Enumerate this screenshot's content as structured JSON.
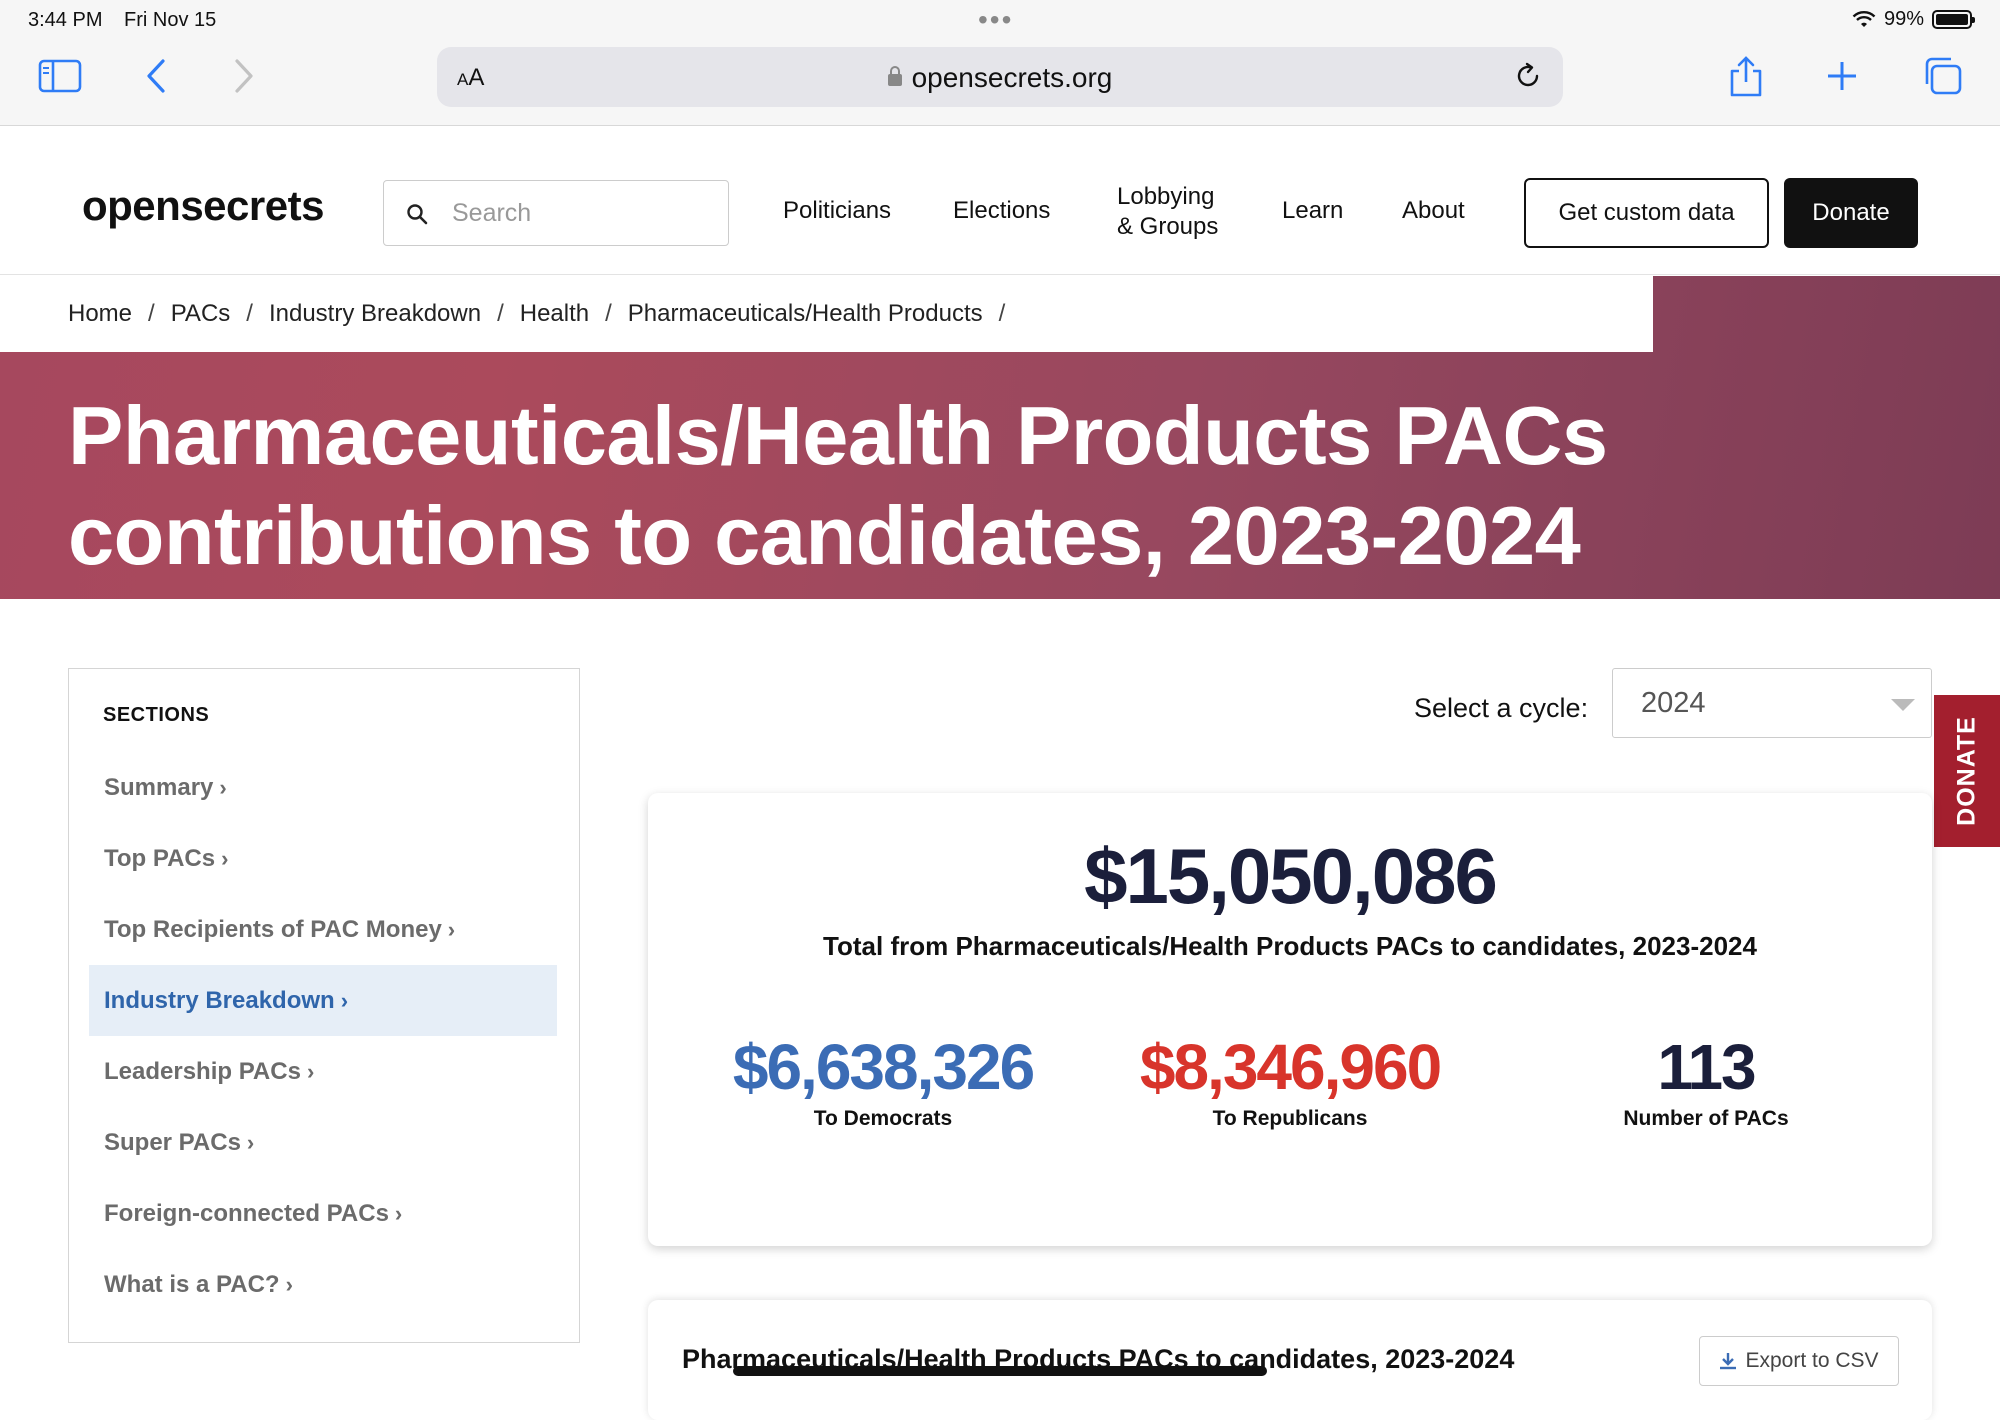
{
  "status_bar": {
    "time": "3:44 PM",
    "date": "Fri Nov 15",
    "battery": "99%"
  },
  "browser": {
    "text_size_label": "AA",
    "url": "opensecrets.org"
  },
  "header": {
    "logo_open": "open",
    "logo_secrets": "secrets",
    "search_placeholder": "Search",
    "nav": [
      "Politicians",
      "Elections",
      "Lobbying",
      "& Groups",
      "Learn",
      "About"
    ],
    "custom_data_label": "Get custom data",
    "donate_label": "Donate"
  },
  "breadcrumbs": [
    "Home",
    "PACs",
    "Industry Breakdown",
    "Health",
    "Pharmaceuticals/Health Products"
  ],
  "hero": {
    "title_line1": "Pharmaceuticals/Health Products PACs",
    "title_line2": "contributions to candidates, 2023-2024"
  },
  "sidebar": {
    "heading": "SECTIONS",
    "items": [
      {
        "label": "Summary",
        "active": false
      },
      {
        "label": "Top PACs",
        "active": false
      },
      {
        "label": "Top Recipients of PAC Money",
        "active": false
      },
      {
        "label": "Industry Breakdown",
        "active": true
      },
      {
        "label": "Leadership PACs",
        "active": false
      },
      {
        "label": "Super PACs",
        "active": false
      },
      {
        "label": "Foreign-connected PACs",
        "active": false
      },
      {
        "label": "What is a PAC?",
        "active": false
      }
    ]
  },
  "cycle": {
    "label": "Select a cycle:",
    "value": "2024"
  },
  "donate_tab": "DONATE",
  "summary": {
    "total": "$15,050,086",
    "total_label": "Total from Pharmaceuticals/Health Products PACs to candidates, 2023-2024",
    "democrats": {
      "value": "$6,638,326",
      "label": "To Democrats",
      "color": "#3b6cb5"
    },
    "republicans": {
      "value": "$8,346,960",
      "label": "To Republicans",
      "color": "#d8342b"
    },
    "pacs": {
      "value": "113",
      "label": "Number of PACs",
      "color": "#1b1f3b"
    }
  },
  "table_card": {
    "title": "Pharmaceuticals/Health Products PACs to candidates, 2023-2024",
    "export_label": "Export to CSV"
  }
}
